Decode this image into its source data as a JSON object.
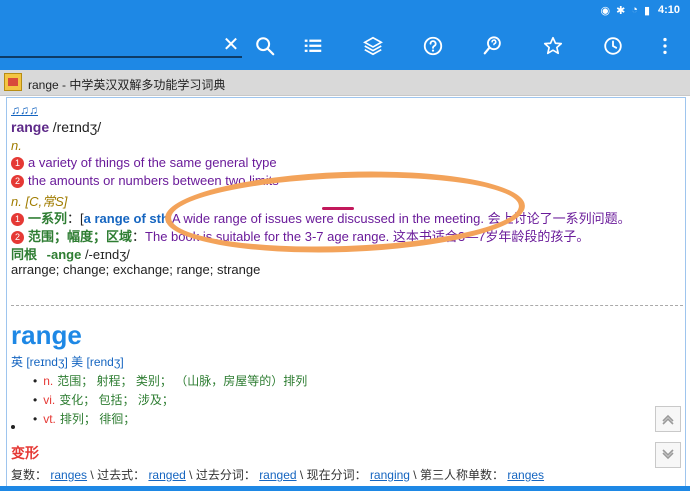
{
  "status": {
    "time": "4:10"
  },
  "dictionary": {
    "title": "range - 中学英汉双解多功能学习词典"
  },
  "entry": {
    "top_link": "♫♫♫",
    "headword": "range",
    "pron": "/reɪndʒ/",
    "pos_n1": "n.",
    "def1": "a variety of things of the same general type",
    "def2": "the amounts or numbers between two limits",
    "pos_n2": "n. [C,常S]",
    "sense1_label": "一系列",
    "sense1_colon": "：",
    "sense1_bracket": "[",
    "sense1_phrase": "a range of sth",
    "sense1_example": "A wide range of issues were discussed in the meeting. 会上讨论了一系列问题。",
    "sense2_label": "范围；幅度；区域",
    "sense2_colon": "：",
    "sense2_example": "The book is suitable for the 3-7 age range. 这本书适合3—7岁年龄段的孩子。",
    "root_label": "同根",
    "root_suffix": "-ange",
    "root_pron": "/-eɪndʒ/",
    "related": "arrange; change; exchange; range; strange"
  },
  "second_entry": {
    "word": "range",
    "phonetics": "英 [reɪndʒ] 美 [rendʒ]",
    "senses": [
      {
        "pos": "n.",
        "text": "范围； 射程； 类别； （山脉，房屋等的）排列"
      },
      {
        "pos": "vi.",
        "text": "变化； 包括； 涉及；"
      },
      {
        "pos": "vt.",
        "text": "排列； 徘徊；"
      }
    ],
    "forms_title": "变形",
    "forms": {
      "plural_label": "复数：",
      "plural": "ranges",
      "sep": " \\ ",
      "past_label": "过去式：",
      "past": "ranged",
      "pp_label": "过去分词：",
      "pp": "ranged",
      "ing_label": "现在分词：",
      "ing": "ranging",
      "third_label": "第三人称单数：",
      "third": "ranges"
    }
  }
}
